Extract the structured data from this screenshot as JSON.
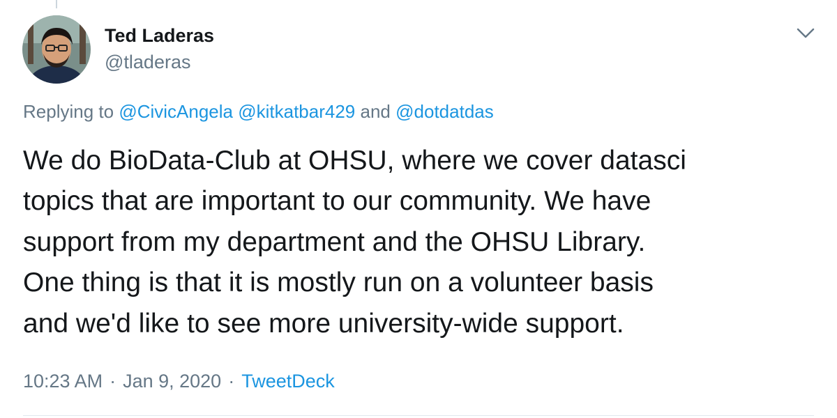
{
  "author": {
    "name": "Ted Laderas",
    "handle": "@tladeras",
    "avatar_icon": "profile-photo"
  },
  "menu": {
    "icon": "chevron-down-icon"
  },
  "reply_context": {
    "prefix": "Replying to",
    "mentions": [
      "@CivicAngela",
      "@kitkatbar429",
      "@dotdatdas"
    ],
    "conjunction": "and"
  },
  "tweet": {
    "lines": [
      "We do BioData-Club at OHSU, where we cover datasci",
      "topics that are important to our community. We have",
      "support from my department and the OHSU Library.",
      "One thing is that it is mostly run on a volunteer basis",
      "and we'd like to see more university-wide support."
    ]
  },
  "meta": {
    "time": "10:23 AM",
    "separator": "·",
    "date": "Jan 9, 2020",
    "source": "TweetDeck"
  },
  "colors": {
    "link": "#1b95e0",
    "secondary_text": "#657786",
    "primary_text": "#14171a",
    "divider": "#e1e8ed"
  }
}
